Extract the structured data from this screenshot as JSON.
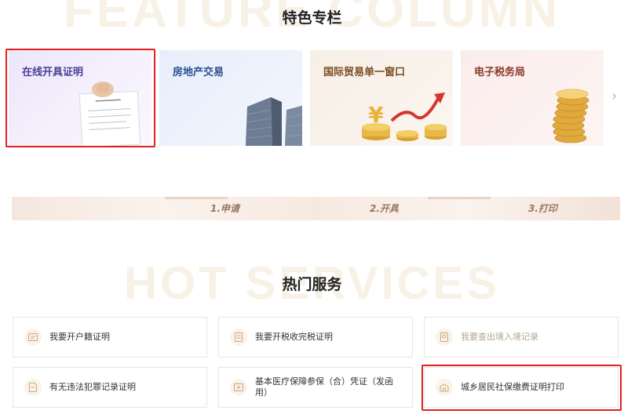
{
  "feature": {
    "bg_word": "FEATURE COLUMN",
    "title": "特色专栏",
    "cards": [
      {
        "label": "在线开具证明"
      },
      {
        "label": "房地产交易"
      },
      {
        "label": "国际贸易单一窗口"
      },
      {
        "label": "电子税务局"
      }
    ],
    "next_icon": "chevron-right-icon"
  },
  "steps": [
    "1.申请",
    "2.开具",
    "3.打印"
  ],
  "hot": {
    "bg_word": "HOT SERVICES",
    "title": "热门服务",
    "services": [
      {
        "label": "我要开户籍证明",
        "icon": "id-card-icon"
      },
      {
        "label": "我要开税收完税证明",
        "icon": "receipt-icon"
      },
      {
        "label": "我要查出境入境记录",
        "icon": "passport-icon"
      },
      {
        "label": "有无违法犯罪记录证明",
        "icon": "document-icon"
      },
      {
        "label": "基本医疗保障参保（合）凭证（发函用）",
        "icon": "medical-card-icon"
      },
      {
        "label": "城乡居民社保缴费证明打印",
        "icon": "social-security-icon"
      }
    ]
  },
  "colors": {
    "highlight": "#e02020",
    "accent": "#b2a48f"
  }
}
